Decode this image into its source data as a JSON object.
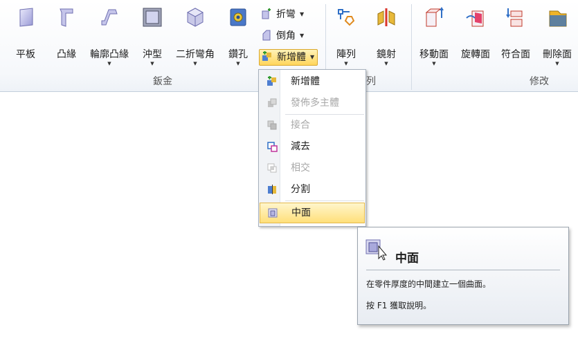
{
  "ribbon": {
    "big_buttons": [
      {
        "key": "flat",
        "label": "平板",
        "icon": "flat-plate-icon"
      },
      {
        "key": "flange",
        "label": "凸緣",
        "icon": "flange-icon"
      },
      {
        "key": "contour",
        "label": "輪廓凸緣",
        "icon": "contour-flange-icon"
      },
      {
        "key": "dimple",
        "label": "沖型",
        "icon": "dimple-icon"
      },
      {
        "key": "jog",
        "label": "二折彎角",
        "icon": "jog-icon"
      },
      {
        "key": "hole",
        "label": "鑽孔",
        "icon": "hole-icon"
      },
      {
        "key": "pattern",
        "label": "陣列",
        "icon": "pattern-icon"
      },
      {
        "key": "mirror",
        "label": "鏡射",
        "icon": "mirror-icon"
      },
      {
        "key": "moveface",
        "label": "移動面",
        "icon": "move-face-icon"
      },
      {
        "key": "rotateface",
        "label": "旋轉面",
        "icon": "rotate-face-icon"
      },
      {
        "key": "matchface",
        "label": "符合面",
        "icon": "match-face-icon"
      },
      {
        "key": "deleteface",
        "label": "刪除面",
        "icon": "delete-face-icon"
      }
    ],
    "small_buttons": {
      "bend": "折彎",
      "chamfer": "倒角",
      "new_body": "新增體"
    },
    "groups": {
      "sheet_metal": "鈑金",
      "pattern_partial": "列",
      "modify": "修改"
    },
    "dropdown_arrow": "▼"
  },
  "menu": {
    "items": [
      {
        "label": "新增體",
        "enabled": true,
        "icon": "new-body-icon"
      },
      {
        "label": "發佈多主體",
        "enabled": false,
        "icon": "publish-multibody-icon"
      },
      {
        "label": "接合",
        "enabled": false,
        "icon": "join-icon"
      },
      {
        "label": "減去",
        "enabled": true,
        "icon": "subtract-icon"
      },
      {
        "label": "相交",
        "enabled": false,
        "icon": "intersect-icon"
      },
      {
        "label": "分割",
        "enabled": true,
        "icon": "split-icon"
      },
      {
        "label": "中面",
        "enabled": true,
        "icon": "midsurface-icon"
      }
    ]
  },
  "tooltip": {
    "title": "中面",
    "description": "在零件厚度的中間建立一個曲面。",
    "help": "按 F1 獲取說明。"
  },
  "colors": {
    "highlight": "#ffd65c",
    "accent_blue": "#2f6fc6",
    "accent_red": "#d9342b"
  }
}
